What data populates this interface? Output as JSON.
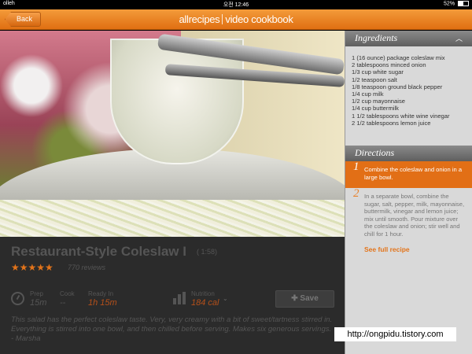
{
  "status_bar": {
    "carrier": "olleh",
    "time": "오전 12:46",
    "battery": "52%"
  },
  "nav": {
    "back_label": "Back",
    "brand_left": "allrecipes",
    "brand_right": "video cookbook"
  },
  "recipe": {
    "title": "Restaurant-Style Coleslaw I",
    "duration": "( 1:58)",
    "rating": 4.5,
    "stars": "★★★★★",
    "reviews": "770 reviews",
    "prep_label": "Prep",
    "prep_value": "15m",
    "cook_label": "Cook",
    "cook_value": "--",
    "ready_label": "Ready In",
    "ready_value": "1h 15m",
    "nutrition_label": "Nutrition",
    "nutrition_value": "184 cal",
    "save_label": "Save",
    "description": "This salad has the perfect coleslaw taste. Very, very creamy with a bit of sweet/tartness stirred in. Everything is stirred into one bowl, and then chilled before serving. Makes six generous servings. - Marsha"
  },
  "sidebar": {
    "ingredients_title": "Ingredients",
    "ingredients": [
      "1 (16 ounce) package coleslaw mix",
      "2 tablespoons minced onion",
      "1/3 cup white sugar",
      "1/2 teaspoon salt",
      "1/8 teaspoon ground black pepper",
      "1/4 cup milk",
      "1/2 cup mayonnaise",
      "1/4 cup buttermilk",
      "1 1/2 tablespoons white wine vinegar",
      "2 1/2 tablespoons lemon juice"
    ],
    "directions_title": "Directions",
    "steps": [
      {
        "num": "1",
        "text": "Combine the coleslaw and onion in a large bowl."
      },
      {
        "num": "2",
        "text": "In a separate bowl, combine the sugar, salt, pepper, milk, mayonnaise, buttermilk, vinegar and lemon juice; mix until smooth. Pour mixture over the coleslaw and onion; stir well and chill for 1 hour."
      }
    ],
    "full_recipe_label": "See full recipe"
  },
  "watermark": "http://ongpidu.tistory.com"
}
